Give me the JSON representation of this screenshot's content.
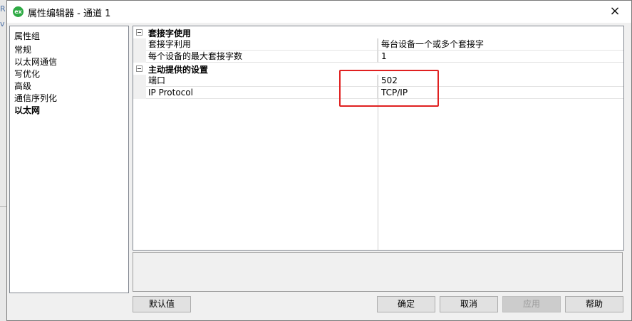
{
  "window": {
    "title": "属性编辑器 - 通道 1",
    "app_icon_text": "ex",
    "close_glyph": "×"
  },
  "backdrop": {
    "glyphs": [
      "R",
      "v"
    ]
  },
  "property_groups": {
    "header": "属性组",
    "items": [
      {
        "label": "常规",
        "selected": false
      },
      {
        "label": "以太网通信",
        "selected": false
      },
      {
        "label": "写优化",
        "selected": false
      },
      {
        "label": "高级",
        "selected": false
      },
      {
        "label": "通信序列化",
        "selected": false
      },
      {
        "label": "以太网",
        "selected": true
      }
    ]
  },
  "properties": {
    "groups": [
      {
        "title": "套接字使用",
        "rows": [
          {
            "name": "套接字利用",
            "value": "每台设备一个或多个套接字"
          },
          {
            "name": "每个设备的最大套接字数",
            "value": "1"
          }
        ]
      },
      {
        "title": "主动提供的设置",
        "rows": [
          {
            "name": "端口",
            "value": "502"
          },
          {
            "name": "IP Protocol",
            "value": "TCP/IP"
          }
        ]
      }
    ]
  },
  "buttons": {
    "default": "默认值",
    "ok": "确定",
    "cancel": "取消",
    "apply": "应用",
    "help": "帮助"
  },
  "colors": {
    "highlight": "#e02020",
    "app_icon": "#2eaa44"
  }
}
